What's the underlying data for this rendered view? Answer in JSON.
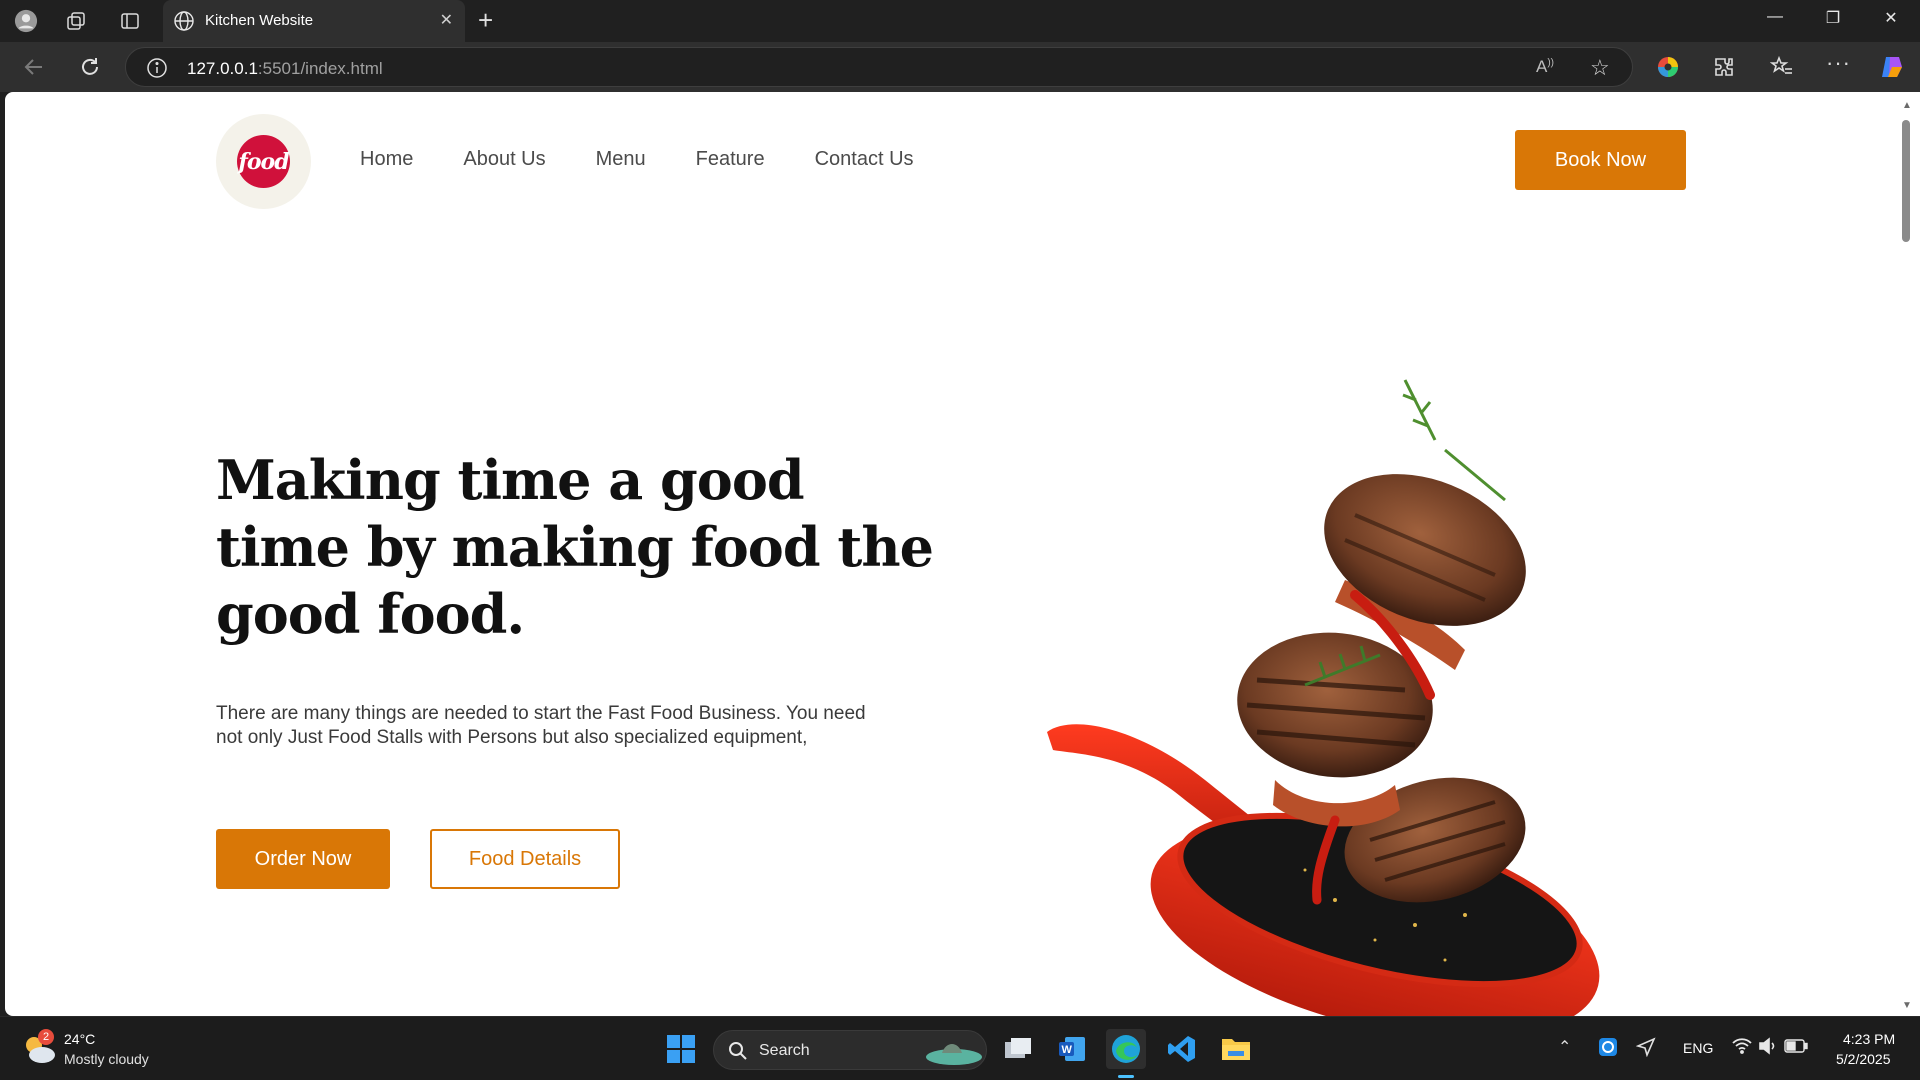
{
  "browser": {
    "tab_title": "Kitchen Website",
    "url_host": "127.0.0.1",
    "url_rest": ":5501/index.html"
  },
  "site": {
    "logo_text": "food",
    "nav": [
      "Home",
      "About Us",
      "Menu",
      "Feature",
      "Contact Us"
    ],
    "book_label": "Book Now",
    "headline": "Making time a good time by making food the good food.",
    "description": "There are many things are needed to start the Fast Food Business. You need not only Just Food Stalls with Persons but also specialized equipment,",
    "order_label": "Order Now",
    "details_label": "Food Details",
    "accent_color": "#d97706"
  },
  "taskbar": {
    "weather_badge": "2",
    "temperature": "24°C",
    "weather": "Mostly cloudy",
    "search_placeholder": "Search",
    "language": "ENG",
    "time": "4:23 PM",
    "date": "5/2/2025"
  }
}
